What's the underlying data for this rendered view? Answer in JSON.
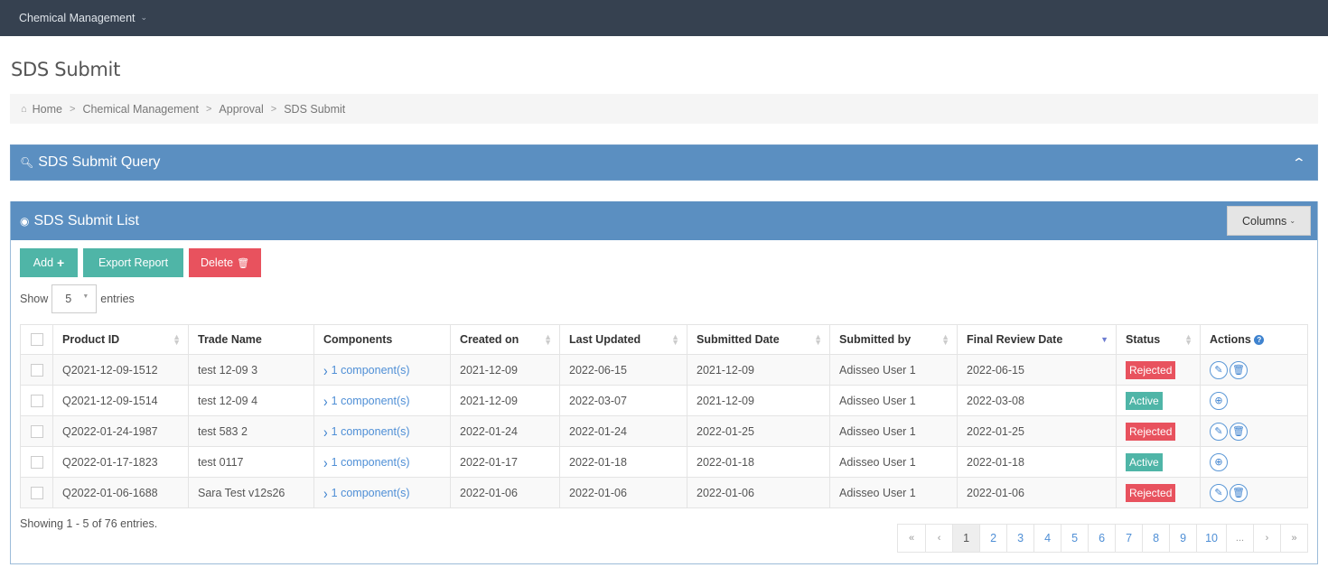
{
  "topbar": {
    "menu_label": "Chemical Management",
    "menu_icon": "chevron-down-icon"
  },
  "page_title": "SDS Submit",
  "breadcrumb": {
    "home_icon": "home-icon",
    "items": [
      "Home",
      "Chemical Management",
      "Approval",
      "SDS Submit"
    ]
  },
  "query_panel": {
    "icon": "search-icon",
    "title": "SDS Submit Query",
    "collapse_icon": "chevron-up-icon"
  },
  "list_panel": {
    "icon": "globe-icon",
    "title": "SDS Submit List",
    "columns_label": "Columns",
    "buttons": {
      "add": "Add",
      "export": "Export Report",
      "delete": "Delete"
    },
    "show_label": "Show",
    "page_size": "5",
    "entries_label": "entries"
  },
  "table": {
    "columns": [
      "Product ID",
      "Trade Name",
      "Components",
      "Created on",
      "Last Updated",
      "Submitted Date",
      "Submitted by",
      "Final Review Date",
      "Status",
      "Actions"
    ],
    "rows": [
      {
        "product_id": "Q2021-12-09-1512",
        "trade_name": "test 12-09 3",
        "components": "1 component(s)",
        "created_on": "2021-12-09",
        "last_updated": "2022-06-15",
        "submitted_date": "2021-12-09",
        "submitted_by": "Adisseo User 1",
        "final_review_date": "2022-06-15",
        "status": "Rejected",
        "actions": [
          "edit",
          "delete"
        ]
      },
      {
        "product_id": "Q2021-12-09-1514",
        "trade_name": "test 12-09 4",
        "components": "1 component(s)",
        "created_on": "2021-12-09",
        "last_updated": "2022-03-07",
        "submitted_date": "2021-12-09",
        "submitted_by": "Adisseo User 1",
        "final_review_date": "2022-03-08",
        "status": "Active",
        "actions": [
          "view"
        ]
      },
      {
        "product_id": "Q2022-01-24-1987",
        "trade_name": "test 583 2",
        "components": "1 component(s)",
        "created_on": "2022-01-24",
        "last_updated": "2022-01-24",
        "submitted_date": "2022-01-25",
        "submitted_by": "Adisseo User 1",
        "final_review_date": "2022-01-25",
        "status": "Rejected",
        "actions": [
          "edit",
          "delete"
        ]
      },
      {
        "product_id": "Q2022-01-17-1823",
        "trade_name": "test 0117",
        "components": "1 component(s)",
        "created_on": "2022-01-17",
        "last_updated": "2022-01-18",
        "submitted_date": "2022-01-18",
        "submitted_by": "Adisseo User 1",
        "final_review_date": "2022-01-18",
        "status": "Active",
        "actions": [
          "view"
        ]
      },
      {
        "product_id": "Q2022-01-06-1688",
        "trade_name": "Sara Test v12s26",
        "components": "1 component(s)",
        "created_on": "2022-01-06",
        "last_updated": "2022-01-06",
        "submitted_date": "2022-01-06",
        "submitted_by": "Adisseo User 1",
        "final_review_date": "2022-01-06",
        "status": "Rejected",
        "actions": [
          "edit",
          "delete"
        ]
      }
    ]
  },
  "footer": {
    "info": "Showing 1 - 5 of 76 entries.",
    "pagination": [
      "«",
      "‹",
      "1",
      "2",
      "3",
      "4",
      "5",
      "6",
      "7",
      "8",
      "9",
      "10",
      "...",
      "›",
      "»"
    ],
    "current_page": "1"
  },
  "colors": {
    "topbar": "#364150",
    "panel": "#5b8fc1",
    "green": "#4fb5a7",
    "red": "#e8525e",
    "link": "#4f8fd6"
  }
}
